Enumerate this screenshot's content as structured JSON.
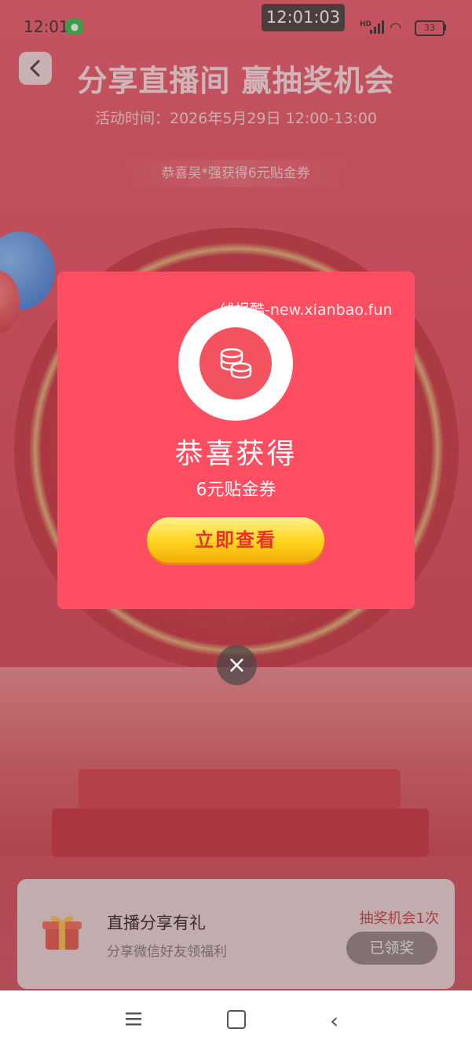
{
  "status_bar": {
    "time": "12:01",
    "clock_overlay": "12:01:03",
    "network": "HD",
    "battery": "33"
  },
  "header": {
    "title": "分享直播间 赢抽奖机会",
    "activity_time": "活动时间：2026年5月29日 12:00-13:00",
    "ticker": "恭喜吴*强获得6元贴金券"
  },
  "modal": {
    "title": "恭喜获得",
    "prize": "6元贴金券",
    "button": "立即查看",
    "watermark": "线报酷-new.xianbao.fun"
  },
  "close": "×",
  "task": {
    "title": "直播分享有礼",
    "subtitle": "分享微信好友领福利",
    "chances": "抽奖机会1次",
    "button": "已领奖"
  },
  "colors": {
    "modal_bg": "#ff4d62",
    "button_yellow": "#ffd21c",
    "accent_red": "#c93a3e"
  },
  "icons": [
    "back-icon",
    "coin-stack-icon",
    "close-icon",
    "gift-icon",
    "menu-icon",
    "home-icon",
    "nav-back-icon",
    "wechat-icon",
    "signal-icon",
    "wifi-icon",
    "battery-icon"
  ]
}
